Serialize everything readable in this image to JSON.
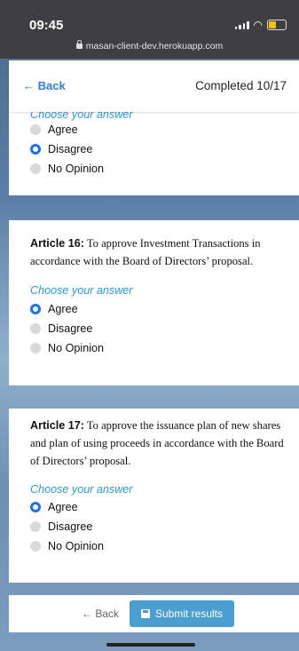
{
  "status": {
    "time": "09:45",
    "url": "masan-client-dev.herokuapp.com"
  },
  "header": {
    "back": "← Back",
    "progress": "Completed 10/17"
  },
  "partial_card": {
    "choose": "Choose your answer",
    "options": [
      "Agree",
      "Disagree",
      "No Opinion"
    ],
    "selected": "Disagree"
  },
  "article16": {
    "label": "Article 16:",
    "text": " To approve Investment Transactions in accordance with the Board of Directors’ proposal.",
    "choose": "Choose your answer",
    "options": [
      "Agree",
      "Disagree",
      "No Opinion"
    ],
    "selected": "Agree"
  },
  "article17": {
    "label": "Article 17:",
    "text": " To approve the issuance plan of new shares and plan of using proceeds in accordance with the Board of Directors’ proposal.",
    "choose": "Choose your answer",
    "options": [
      "Agree",
      "Disagree",
      "No Opinion"
    ],
    "selected": "Agree"
  },
  "footer": {
    "back": "← Back",
    "submit": "Submit results"
  },
  "colors": {
    "accent": "#1a73e8",
    "link": "#2e7dd1",
    "choose": "#2a9ad6",
    "submit": "#4a9fd0"
  },
  "icons": {
    "lock": "lock-icon",
    "save": "save-icon",
    "signal": "signal-icon",
    "wifi": "wifi-icon",
    "battery": "battery-icon"
  }
}
